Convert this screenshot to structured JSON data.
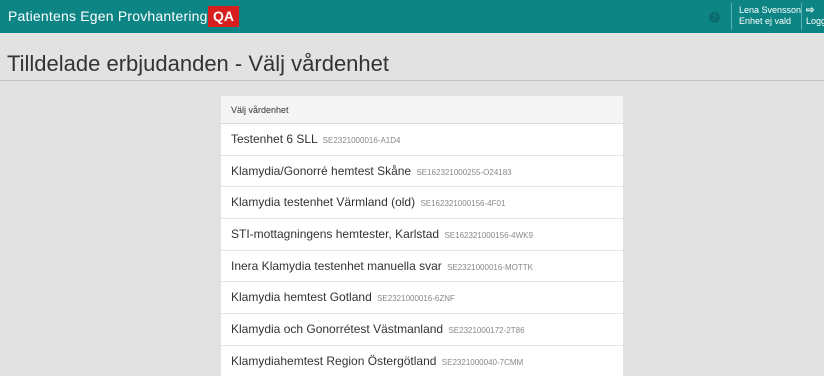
{
  "header": {
    "app_title": "Patientens Egen Provhantering",
    "env_badge": "QA",
    "help_glyph": "?",
    "user_name": "Lena Svensson",
    "unit_status": "Enhet ej vald",
    "logout_label": "Logga ut"
  },
  "page": {
    "title": "Tilldelade erbjudanden - Välj vårdenhet"
  },
  "panel": {
    "heading": "Välj vårdenhet",
    "items": [
      {
        "name": "Testenhet 6 SLL",
        "code": "SE2321000016-A1D4"
      },
      {
        "name": "Klamydia/Gonorré hemtest Skåne",
        "code": "SE162321000255-O24183"
      },
      {
        "name": "Klamydia testenhet Värmland (old)",
        "code": "SE162321000156-4F01"
      },
      {
        "name": "STI-mottagningens hemtester, Karlstad",
        "code": "SE162321000156-4WK9"
      },
      {
        "name": "Inera Klamydia testenhet manuella svar",
        "code": "SE2321000016-MOTTK"
      },
      {
        "name": "Klamydia hemtest Gotland",
        "code": "SE2321000016-6ZNF"
      },
      {
        "name": "Klamydia och Gonorrétest Västmanland",
        "code": "SE2321000172-2T86"
      },
      {
        "name": "Klamydiahemtest Region Östergötland",
        "code": "SE2321000040-7CMM"
      }
    ]
  },
  "colors": {
    "header_bg": "#0e8585",
    "badge_bg": "#d81e1e",
    "page_bg": "#e2e2e2"
  },
  "icons": {
    "help": "help-icon",
    "logout": "logout-icon"
  }
}
